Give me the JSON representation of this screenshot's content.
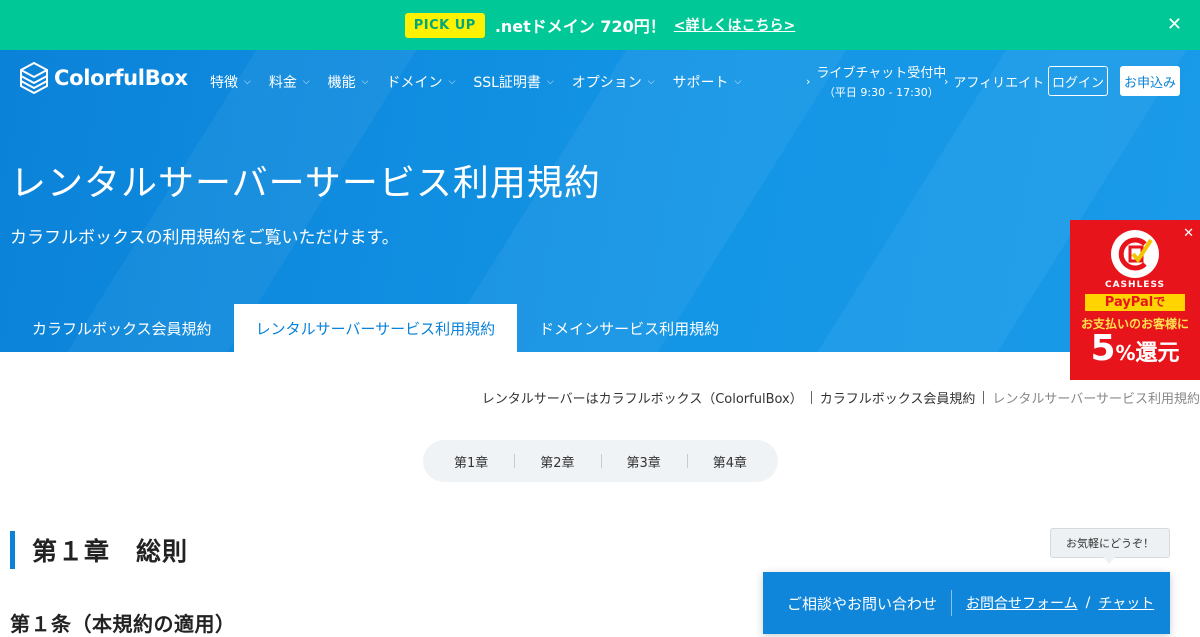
{
  "promo": {
    "badge": "PICK UP",
    "message": ".netドメイン 720円！",
    "link": "<詳しくはこちら>",
    "close_icon": "close-icon"
  },
  "header": {
    "logo_text": "ColorfulBox",
    "nav": [
      {
        "label": "特徴"
      },
      {
        "label": "料金"
      },
      {
        "label": "機能"
      },
      {
        "label": "ドメイン"
      },
      {
        "label": "SSL証明書"
      },
      {
        "label": "オプション"
      },
      {
        "label": "サポート"
      }
    ],
    "chat_label": "ライブチャット受付中",
    "chat_hours": "（平日 9:30 - 17:30）",
    "affiliate": "アフィリエイト",
    "login": "ログイン",
    "apply": "お申込み"
  },
  "hero": {
    "title": "レンタルサーバーサービス利用規約",
    "subtitle": "カラフルボックスの利用規約をご覧いただけます。"
  },
  "tabs": [
    {
      "label": "カラフルボックス会員規約",
      "active": false
    },
    {
      "label": "レンタルサーバーサービス利用規約",
      "active": true
    },
    {
      "label": "ドメインサービス利用規約",
      "active": false
    }
  ],
  "cashless": {
    "brand": "CASHLESS",
    "paypal": "PayPal",
    "paypal_suffix": "で",
    "line2": "お支払いのお客様に",
    "percent": "5",
    "percent_sign": "%",
    "reward": "還元"
  },
  "breadcrumb": [
    "レンタルサーバーはカラフルボックス（ColorfulBox）",
    "カラフルボックス会員規約",
    "レンタルサーバーサービス利用規約"
  ],
  "chapters": [
    "第1章",
    "第2章",
    "第3章",
    "第4章"
  ],
  "content": {
    "chapter_heading": "第１章　総則",
    "article_heading": "第１条（本規約の適用）"
  },
  "contact": {
    "bubble": "お気軽にどうぞ！",
    "label": "ご相談やお問い合わせ",
    "form_link": "お問合せフォーム",
    "slash": "/",
    "chat_link": "チャット"
  },
  "colors": {
    "promo_bg": "#00c896",
    "hero_blue": "#0a82d8",
    "cashless_red": "#e8141b"
  }
}
